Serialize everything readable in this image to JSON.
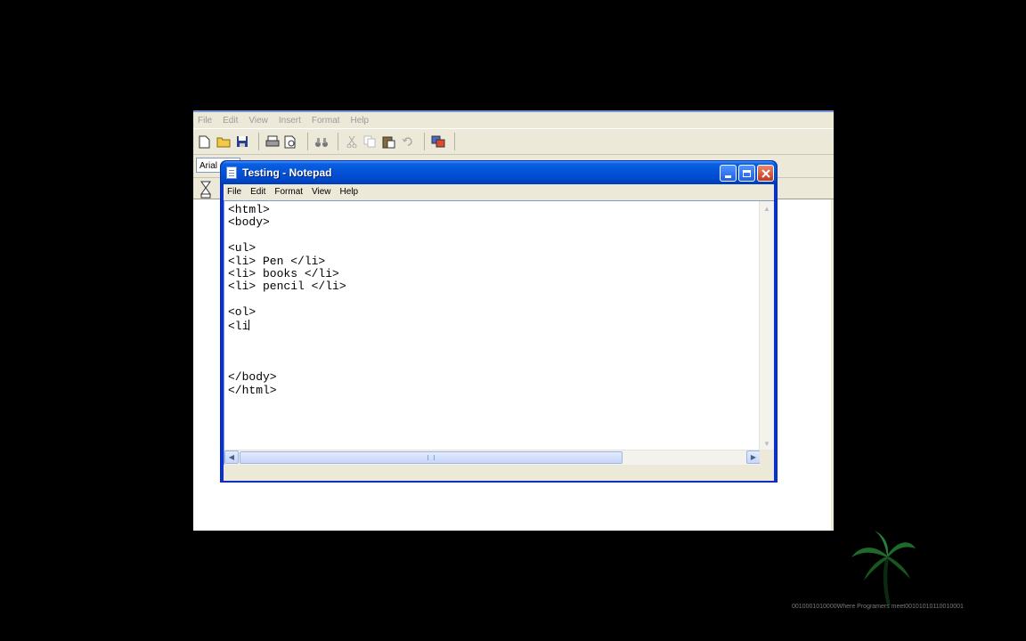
{
  "wordpad": {
    "menu": [
      "File",
      "Edit",
      "View",
      "Insert",
      "Format",
      "Help"
    ],
    "font_value": "Arial"
  },
  "notepad": {
    "title": "Testing - Notepad",
    "menu": [
      "File",
      "Edit",
      "Format",
      "View",
      "Help"
    ],
    "lines": [
      "<html>",
      "<body>",
      "",
      "<ul>",
      "<li> Pen </li>",
      "<li> books </li>",
      "<li> pencil </li>",
      "",
      "<ol>",
      "<li",
      "",
      "",
      "",
      "</body>",
      "</html>"
    ],
    "caret_line": 9
  },
  "watermark": {
    "text": "0010001010000Where Programers meet00101010110010001"
  },
  "colors": {
    "titlebar": "#0054e3",
    "desktop": "#000000"
  }
}
